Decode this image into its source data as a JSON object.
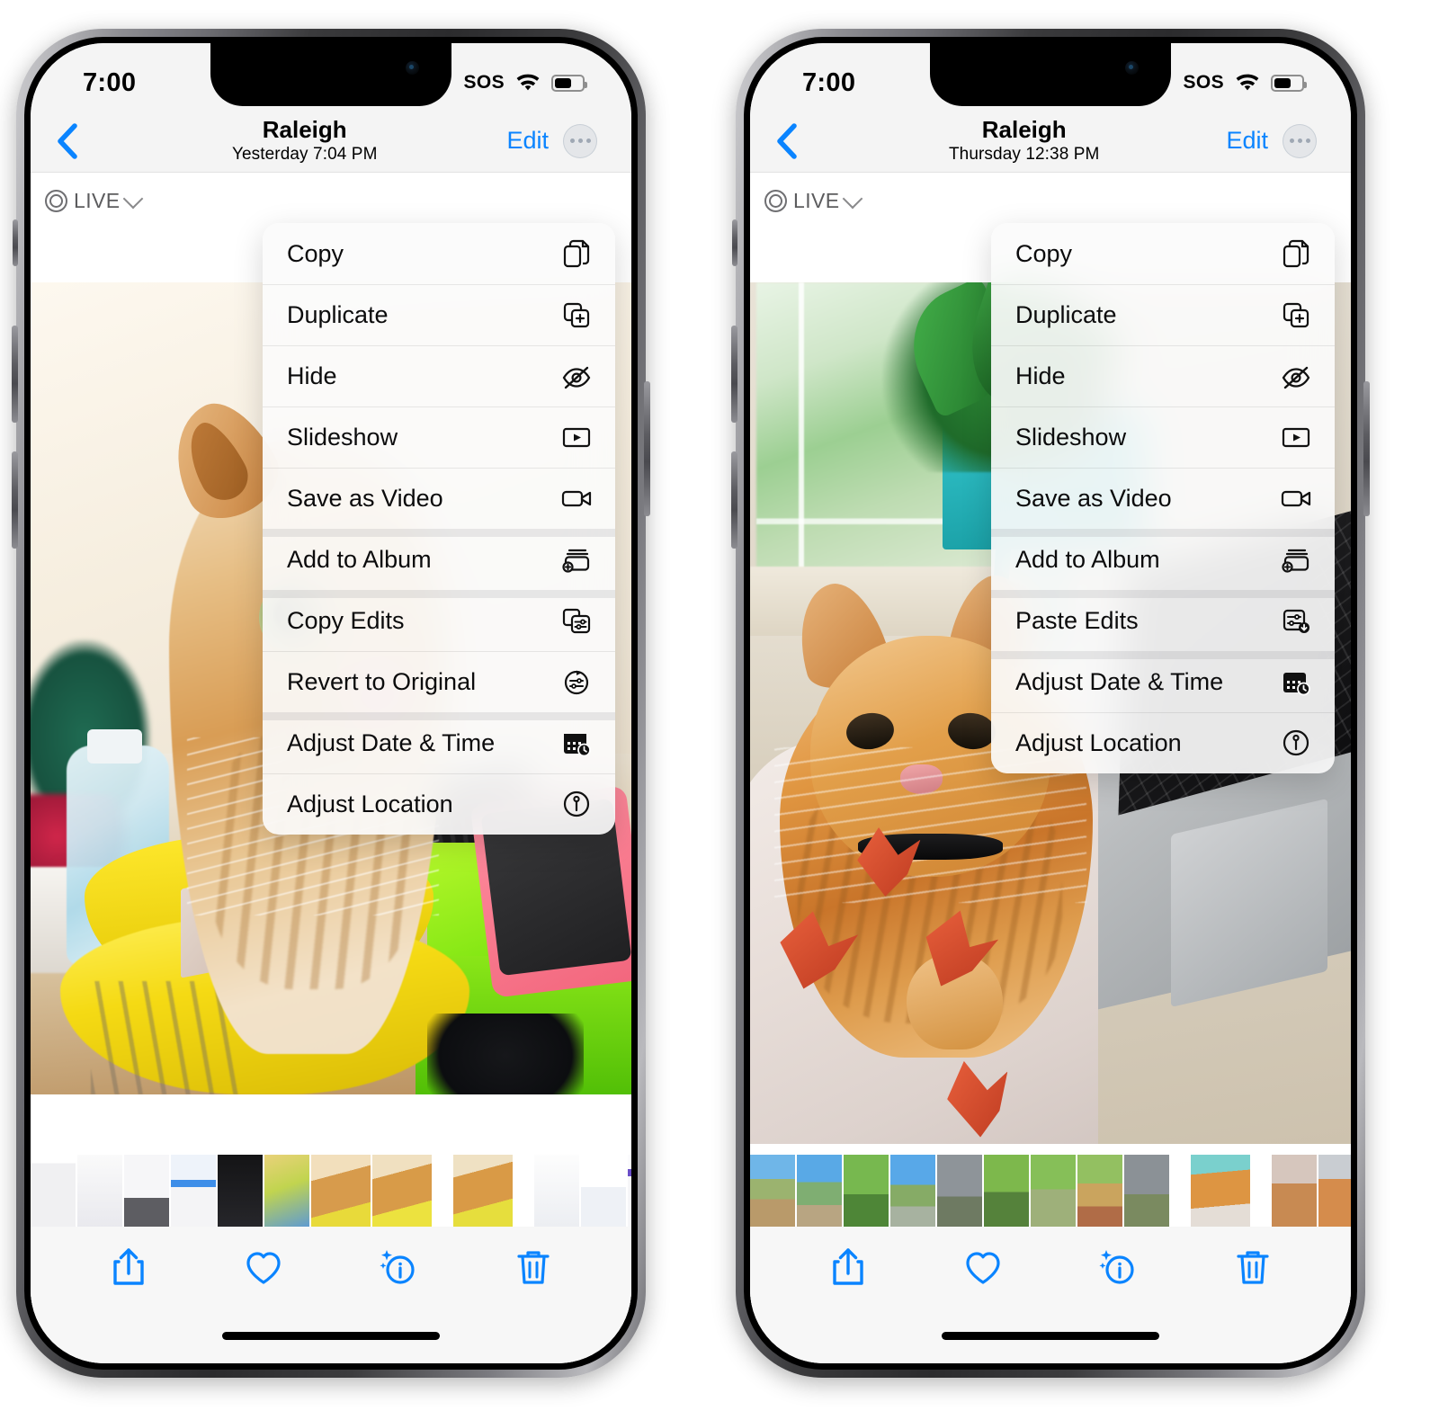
{
  "app": "Photos",
  "phones": [
    {
      "id": "left",
      "status_bar": {
        "time": "7:00",
        "sos": "SOS",
        "wifi_icon": "wifi-icon",
        "battery_icon": "battery-icon",
        "battery_level": 60
      },
      "nav": {
        "back_icon": "chevron-left-icon",
        "title": "Raleigh",
        "subtitle": "Yesterday  7:04 PM",
        "edit_label": "Edit",
        "more_icon": "ellipsis-circle-icon"
      },
      "live_badge": {
        "label": "LIVE",
        "icon": "live-photo-icon",
        "chevron": "chevron-down-icon"
      },
      "menu_items": [
        {
          "label": "Copy",
          "icon": "copy-icon",
          "group_start": false
        },
        {
          "label": "Duplicate",
          "icon": "duplicate-icon",
          "group_start": false
        },
        {
          "label": "Hide",
          "icon": "eye-slash-icon",
          "group_start": false
        },
        {
          "label": "Slideshow",
          "icon": "play-rectangle-icon",
          "group_start": false
        },
        {
          "label": "Save as Video",
          "icon": "video-camera-icon",
          "group_start": false
        },
        {
          "label": "Add to Album",
          "icon": "add-to-album-icon",
          "group_start": true
        },
        {
          "label": "Copy Edits",
          "icon": "copy-edits-icon",
          "group_start": true
        },
        {
          "label": "Revert to Original",
          "icon": "revert-icon",
          "group_start": false
        },
        {
          "label": "Adjust Date & Time",
          "icon": "calendar-clock-icon",
          "group_start": true
        },
        {
          "label": "Adjust Location",
          "icon": "location-pin-icon",
          "group_start": false
        }
      ],
      "toolbar": [
        {
          "icon": "share-icon",
          "name": "share-button"
        },
        {
          "icon": "heart-icon",
          "name": "favorite-button"
        },
        {
          "icon": "info-sparkle-icon",
          "name": "info-button"
        },
        {
          "icon": "trash-icon",
          "name": "delete-button"
        }
      ],
      "filmstrip_count": 16
    },
    {
      "id": "right",
      "status_bar": {
        "time": "7:00",
        "sos": "SOS",
        "wifi_icon": "wifi-icon",
        "battery_icon": "battery-icon",
        "battery_level": 60
      },
      "nav": {
        "back_icon": "chevron-left-icon",
        "title": "Raleigh",
        "subtitle": "Thursday  12:38 PM",
        "edit_label": "Edit",
        "more_icon": "ellipsis-circle-icon"
      },
      "live_badge": {
        "label": "LIVE",
        "icon": "live-photo-icon",
        "chevron": "chevron-down-icon"
      },
      "menu_items": [
        {
          "label": "Copy",
          "icon": "copy-icon",
          "group_start": false
        },
        {
          "label": "Duplicate",
          "icon": "duplicate-icon",
          "group_start": false
        },
        {
          "label": "Hide",
          "icon": "eye-slash-icon",
          "group_start": false
        },
        {
          "label": "Slideshow",
          "icon": "play-rectangle-icon",
          "group_start": false
        },
        {
          "label": "Save as Video",
          "icon": "video-camera-icon",
          "group_start": false
        },
        {
          "label": "Add to Album",
          "icon": "add-to-album-icon",
          "group_start": true
        },
        {
          "label": "Paste Edits",
          "icon": "paste-edits-icon",
          "group_start": true
        },
        {
          "label": "Adjust Date & Time",
          "icon": "calendar-clock-icon",
          "group_start": true
        },
        {
          "label": "Adjust Location",
          "icon": "location-pin-icon",
          "group_start": false
        }
      ],
      "toolbar": [
        {
          "icon": "share-icon",
          "name": "share-button"
        },
        {
          "icon": "heart-icon",
          "name": "favorite-button"
        },
        {
          "icon": "info-sparkle-icon",
          "name": "info-button"
        },
        {
          "icon": "trash-icon",
          "name": "delete-button"
        }
      ],
      "filmstrip_count": 18
    }
  ],
  "colors": {
    "accent": "#0a84ff",
    "menu_bg": "#fafafa",
    "chrome_bg": "#f4f4f4",
    "text": "#0b0b0c"
  }
}
